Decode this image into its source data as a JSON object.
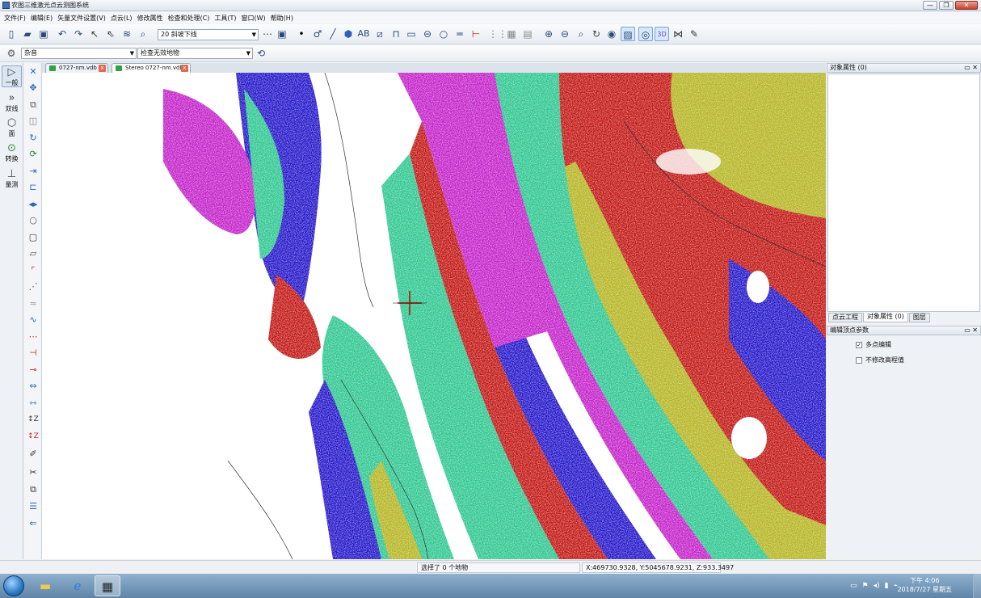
{
  "window": {
    "title": "农图三维激光点云测图系统",
    "minimize": "—",
    "restore": "❐",
    "close": "✕"
  },
  "menu": [
    "文件(F)",
    "编辑(E)",
    "矢量文件设置(V)",
    "点云(L)",
    "修改属性",
    "检查和处理(C)",
    "工具(T)",
    "窗口(W)",
    "帮助(H)"
  ],
  "toolbar": {
    "layer_combo": "20 斜坡下线",
    "icons": [
      "new-file-icon",
      "open-file-icon",
      "save-icon",
      "undo-icon",
      "redo-icon",
      "select-arrow-icon",
      "select-plus-icon",
      "layers-icon",
      "find-icon"
    ],
    "draw_icons": [
      "point-icon",
      "arc-icon",
      "line-icon",
      "polyline-icon",
      "fill-shape-icon",
      "text-ab-icon",
      "cross-box-icon",
      "rectangle-icon",
      "circle-3p-icon",
      "circle-icon",
      "parallel-icon",
      "dash-line-icon",
      "grid-dots-icon",
      "grid-box-icon",
      "grid-f-icon"
    ],
    "view_icons": [
      "zoom-in-icon",
      "zoom-out-icon",
      "zoom-window-icon",
      "rotate-icon",
      "globe-icon",
      "image-icon",
      "point-view-icon",
      "3d-view-icon",
      "network-icon",
      "pen-icon"
    ]
  },
  "toolbar2": {
    "filter_combo": "杂音",
    "check_combo": "检查无效地物"
  },
  "left_tools": [
    {
      "icon": "▷",
      "label": "一般"
    },
    {
      "icon": "»",
      "label": "双线"
    },
    {
      "icon": "⬡",
      "label": "面"
    },
    {
      "icon": "⊙",
      "label": "转换"
    },
    {
      "icon": "⊥",
      "label": "量测"
    }
  ],
  "tabs": [
    {
      "label": "0727-nm.vdb",
      "close": "x"
    },
    {
      "label": "Stereo 0727-nm.vdb",
      "close": "x"
    }
  ],
  "right_panel": {
    "props_title": "对象属性 (0)",
    "panel_btns": "▭ ✕",
    "tabs": [
      "点云工程",
      "对象属性 (0)",
      "图层"
    ],
    "edit_title": "编辑顶点参数",
    "options": [
      {
        "label": "多点编辑",
        "checked": "✓"
      },
      {
        "label": "不修改高程值",
        "checked": ""
      }
    ]
  },
  "status": {
    "selection": "选择了 0 个地物",
    "coords": "X:469730.9328, Y:5045678.9231, Z:933.3497"
  },
  "taskbar": {
    "apps": [
      "folder-icon",
      "ie-icon",
      "app-icon"
    ],
    "time": "下午 4:06",
    "date": "2018/7/27 星期五"
  },
  "map_colors": {
    "yellow": "#b3b21b",
    "red": "#c00f0c",
    "blue": "#1d0fc8",
    "magenta": "#c21ac8",
    "green": "#27c58c",
    "white": "#ffffff"
  }
}
